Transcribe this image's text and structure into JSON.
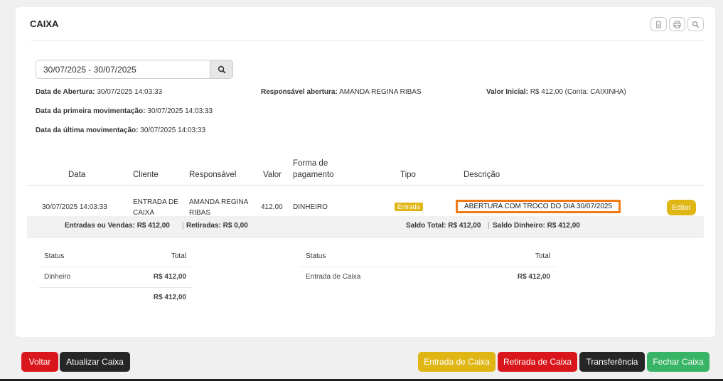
{
  "header": {
    "title": "CAIXA"
  },
  "tools": [
    {
      "icon": "file-pdf-icon"
    },
    {
      "icon": "print-icon"
    },
    {
      "icon": "search-icon"
    }
  ],
  "filter": {
    "date_range": "30/07/2025 - 30/07/2025"
  },
  "info": {
    "abertura_label": "Data de Abertura:",
    "abertura_value": "30/07/2025 14:03:33",
    "responsavel_label": "Responsável abertura:",
    "responsavel_value": "AMANDA REGINA RIBAS",
    "valor_inicial_label": "Valor Inicial:",
    "valor_inicial_value": "R$ 412,00 (Conta: CAIXINHA)",
    "primeira_label": "Data da primeira movimentação:",
    "primeira_value": "30/07/2025 14:03:33",
    "ultima_label": "Data da última movimentação:",
    "ultima_value": "30/07/2025 14:03:33"
  },
  "table": {
    "headers": {
      "data": "Data",
      "cliente": "Cliente",
      "responsavel": "Responsável",
      "valor": "Valor",
      "forma_1": "Forma de",
      "forma_2": "pagamento",
      "tipo": "Tipo",
      "descricao": "Descrição"
    },
    "rows": [
      {
        "data": "30/07/2025 14:03:33",
        "cliente_1": "ENTRADA DE",
        "cliente_2": "CAIXA",
        "responsavel_1": "AMANDA REGINA",
        "responsavel_2": "RIBAS",
        "valor": "412,00",
        "forma": "DINHEIRO",
        "tipo": "Entrada",
        "descricao": "ABERTURA COM TROCO DO DIA 30/07/2025",
        "action": "Editar"
      }
    ]
  },
  "totals": {
    "entradas": "Entradas ou Vendas: R$ 412,00",
    "sep": "|",
    "retiradas": "Retiradas: R$ 0,00",
    "saldo_total": "Saldo Total: R$ 412,00",
    "saldo_dinheiro": "Saldo Dinheiro: R$ 412,00"
  },
  "summary_left": {
    "status_header": "Status",
    "total_header": "Total",
    "row_status": "Dinheiro",
    "row_total": "R$ 412,00",
    "grand_total": "R$ 412,00"
  },
  "summary_right": {
    "status_header": "Status",
    "total_header": "Total",
    "row_status": "Entrada de Caixa",
    "row_total": "R$ 412,00"
  },
  "buttons": {
    "voltar": "Voltar",
    "atualizar": "Atualizar Caixa",
    "entrada": "Entrada de Caixa",
    "retirada": "Retirada de Caixa",
    "transferencia": "Transferência",
    "fechar": "Fechar Caixa"
  },
  "colors": {
    "red": "#d9161c",
    "dark": "#262626",
    "yellow": "#e0b614",
    "green": "#38b466",
    "highlight": "#f07a14"
  }
}
